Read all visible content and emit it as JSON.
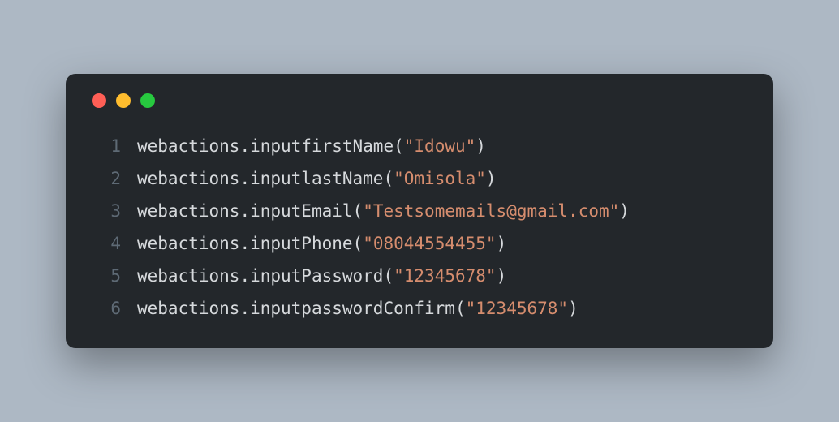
{
  "window": {
    "traffic_light_colors": {
      "close": "#ff5f56",
      "minimize": "#ffbd2e",
      "zoom": "#27c93f"
    }
  },
  "code": {
    "lines": [
      {
        "no": "1",
        "object": "webactions",
        "method": "inputfirstName",
        "arg": "\"Idowu\""
      },
      {
        "no": "2",
        "object": "webactions",
        "method": "inputlastName",
        "arg": "\"Omisola\""
      },
      {
        "no": "3",
        "object": "webactions",
        "method": "inputEmail",
        "arg": "\"Testsomemails@gmail.com\""
      },
      {
        "no": "4",
        "object": "webactions",
        "method": "inputPhone",
        "arg": "\"08044554455\""
      },
      {
        "no": "5",
        "object": "webactions",
        "method": "inputPassword",
        "arg": "\"12345678\""
      },
      {
        "no": "6",
        "object": "webactions",
        "method": "inputpasswordConfirm",
        "arg": "\"12345678\""
      }
    ]
  }
}
